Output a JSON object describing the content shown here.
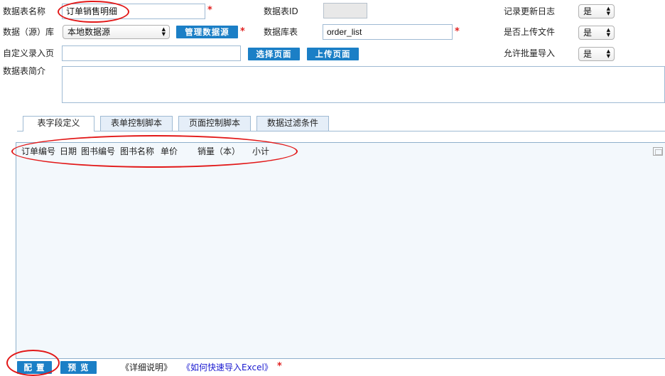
{
  "form": {
    "table_name": {
      "label": "数据表名称",
      "value": "订单销售明细"
    },
    "table_id": {
      "label": "数据表ID",
      "value": ""
    },
    "update_log": {
      "label": "记录更新日志",
      "value": "是"
    },
    "datasource": {
      "label": "数据（源）库",
      "value": "本地数据源",
      "manage_button": "管理数据源"
    },
    "db_table": {
      "label": "数据库表",
      "value": "order_list"
    },
    "upload_file": {
      "label": "是否上传文件",
      "value": "是"
    },
    "custom_page": {
      "label": "自定义录入页",
      "value": "",
      "select_button": "选择页面",
      "upload_button": "上传页面"
    },
    "batch_import": {
      "label": "允许批量导入",
      "value": "是"
    },
    "description": {
      "label": "数据表简介",
      "value": ""
    },
    "required_mark": "*"
  },
  "tabs": [
    {
      "label": "表字段定义",
      "active": true
    },
    {
      "label": "表单控制脚本",
      "active": false
    },
    {
      "label": "页面控制脚本",
      "active": false
    },
    {
      "label": "数据过滤条件",
      "active": false
    }
  ],
  "editor": {
    "fields": [
      "订单编号",
      "日期",
      "图书编号",
      "图书名称",
      "单价",
      "销量（本）",
      "小计"
    ]
  },
  "footer": {
    "config_button": "配 置",
    "preview_button": "预 览",
    "detail_link": "《详细说明》",
    "excel_link": "《如何快速导入Excel》",
    "required_mark": "*"
  },
  "colors": {
    "accent": "#1b7fc6",
    "annotation": "#e21818",
    "required": "#e0201f",
    "link": "#1a1ad0"
  }
}
